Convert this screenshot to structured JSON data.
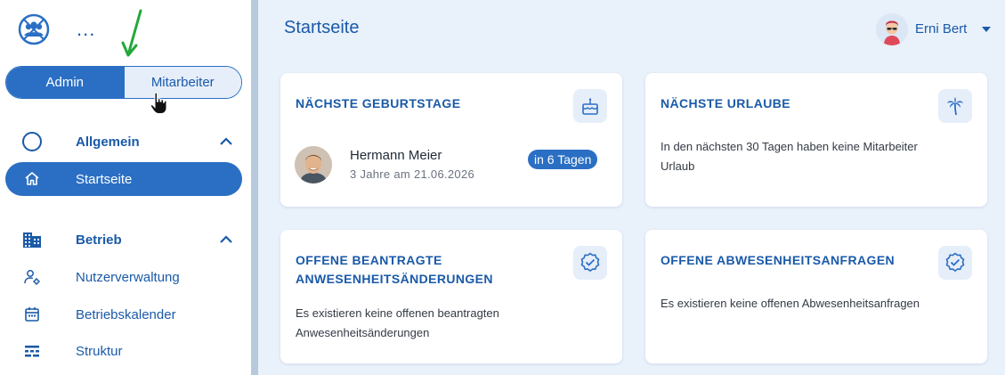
{
  "sidebar": {
    "more_label": "...",
    "role_toggle": {
      "admin": "Admin",
      "employee": "Mitarbeiter",
      "selected": "Admin"
    },
    "groups": [
      {
        "label": "Allgemein",
        "icon": "circle-icon",
        "expanded": true
      },
      {
        "label": "Betrieb",
        "icon": "building-icon",
        "expanded": true
      }
    ],
    "items": [
      {
        "label": "Startseite",
        "icon": "home-icon",
        "active": true
      },
      {
        "label": "Nutzerverwaltung",
        "icon": "user-settings-icon",
        "active": false
      },
      {
        "label": "Betriebskalender",
        "icon": "calendar-icon",
        "active": false
      },
      {
        "label": "Struktur",
        "icon": "structure-icon",
        "active": false
      }
    ]
  },
  "header": {
    "title": "Startseite",
    "user_name": "Erni Bert"
  },
  "cards": {
    "birthdays": {
      "title": "NÄCHSTE GEBURTSTAGE",
      "icon": "cake-icon",
      "person_name": "Hermann Meier",
      "person_detail": "3 Jahre am 21.06.2026",
      "badge": "in 6 Tagen"
    },
    "vacations": {
      "title": "NÄCHSTE URLAUBE",
      "icon": "palm-tree-icon",
      "text": "In den nächsten 30 Tagen haben keine Mitarbeiter Urlaub"
    },
    "attendance": {
      "title": "OFFENE BEANTRAGTE ANWESENHEITSÄNDERUNGEN",
      "icon": "verified-badge-icon",
      "text": "Es existieren keine offenen beantragten Anwesenheitsänderungen"
    },
    "absence": {
      "title": "OFFENE ABWESENHEITSANFRAGEN",
      "icon": "verified-badge-icon",
      "text": "Es existieren keine offenen Abwesenheitsanfragen"
    }
  },
  "colors": {
    "primary": "#2b6fc4",
    "primary_text": "#1a5aa8",
    "background": "#e9f1fb",
    "annotation_arrow": "#22a83a"
  }
}
